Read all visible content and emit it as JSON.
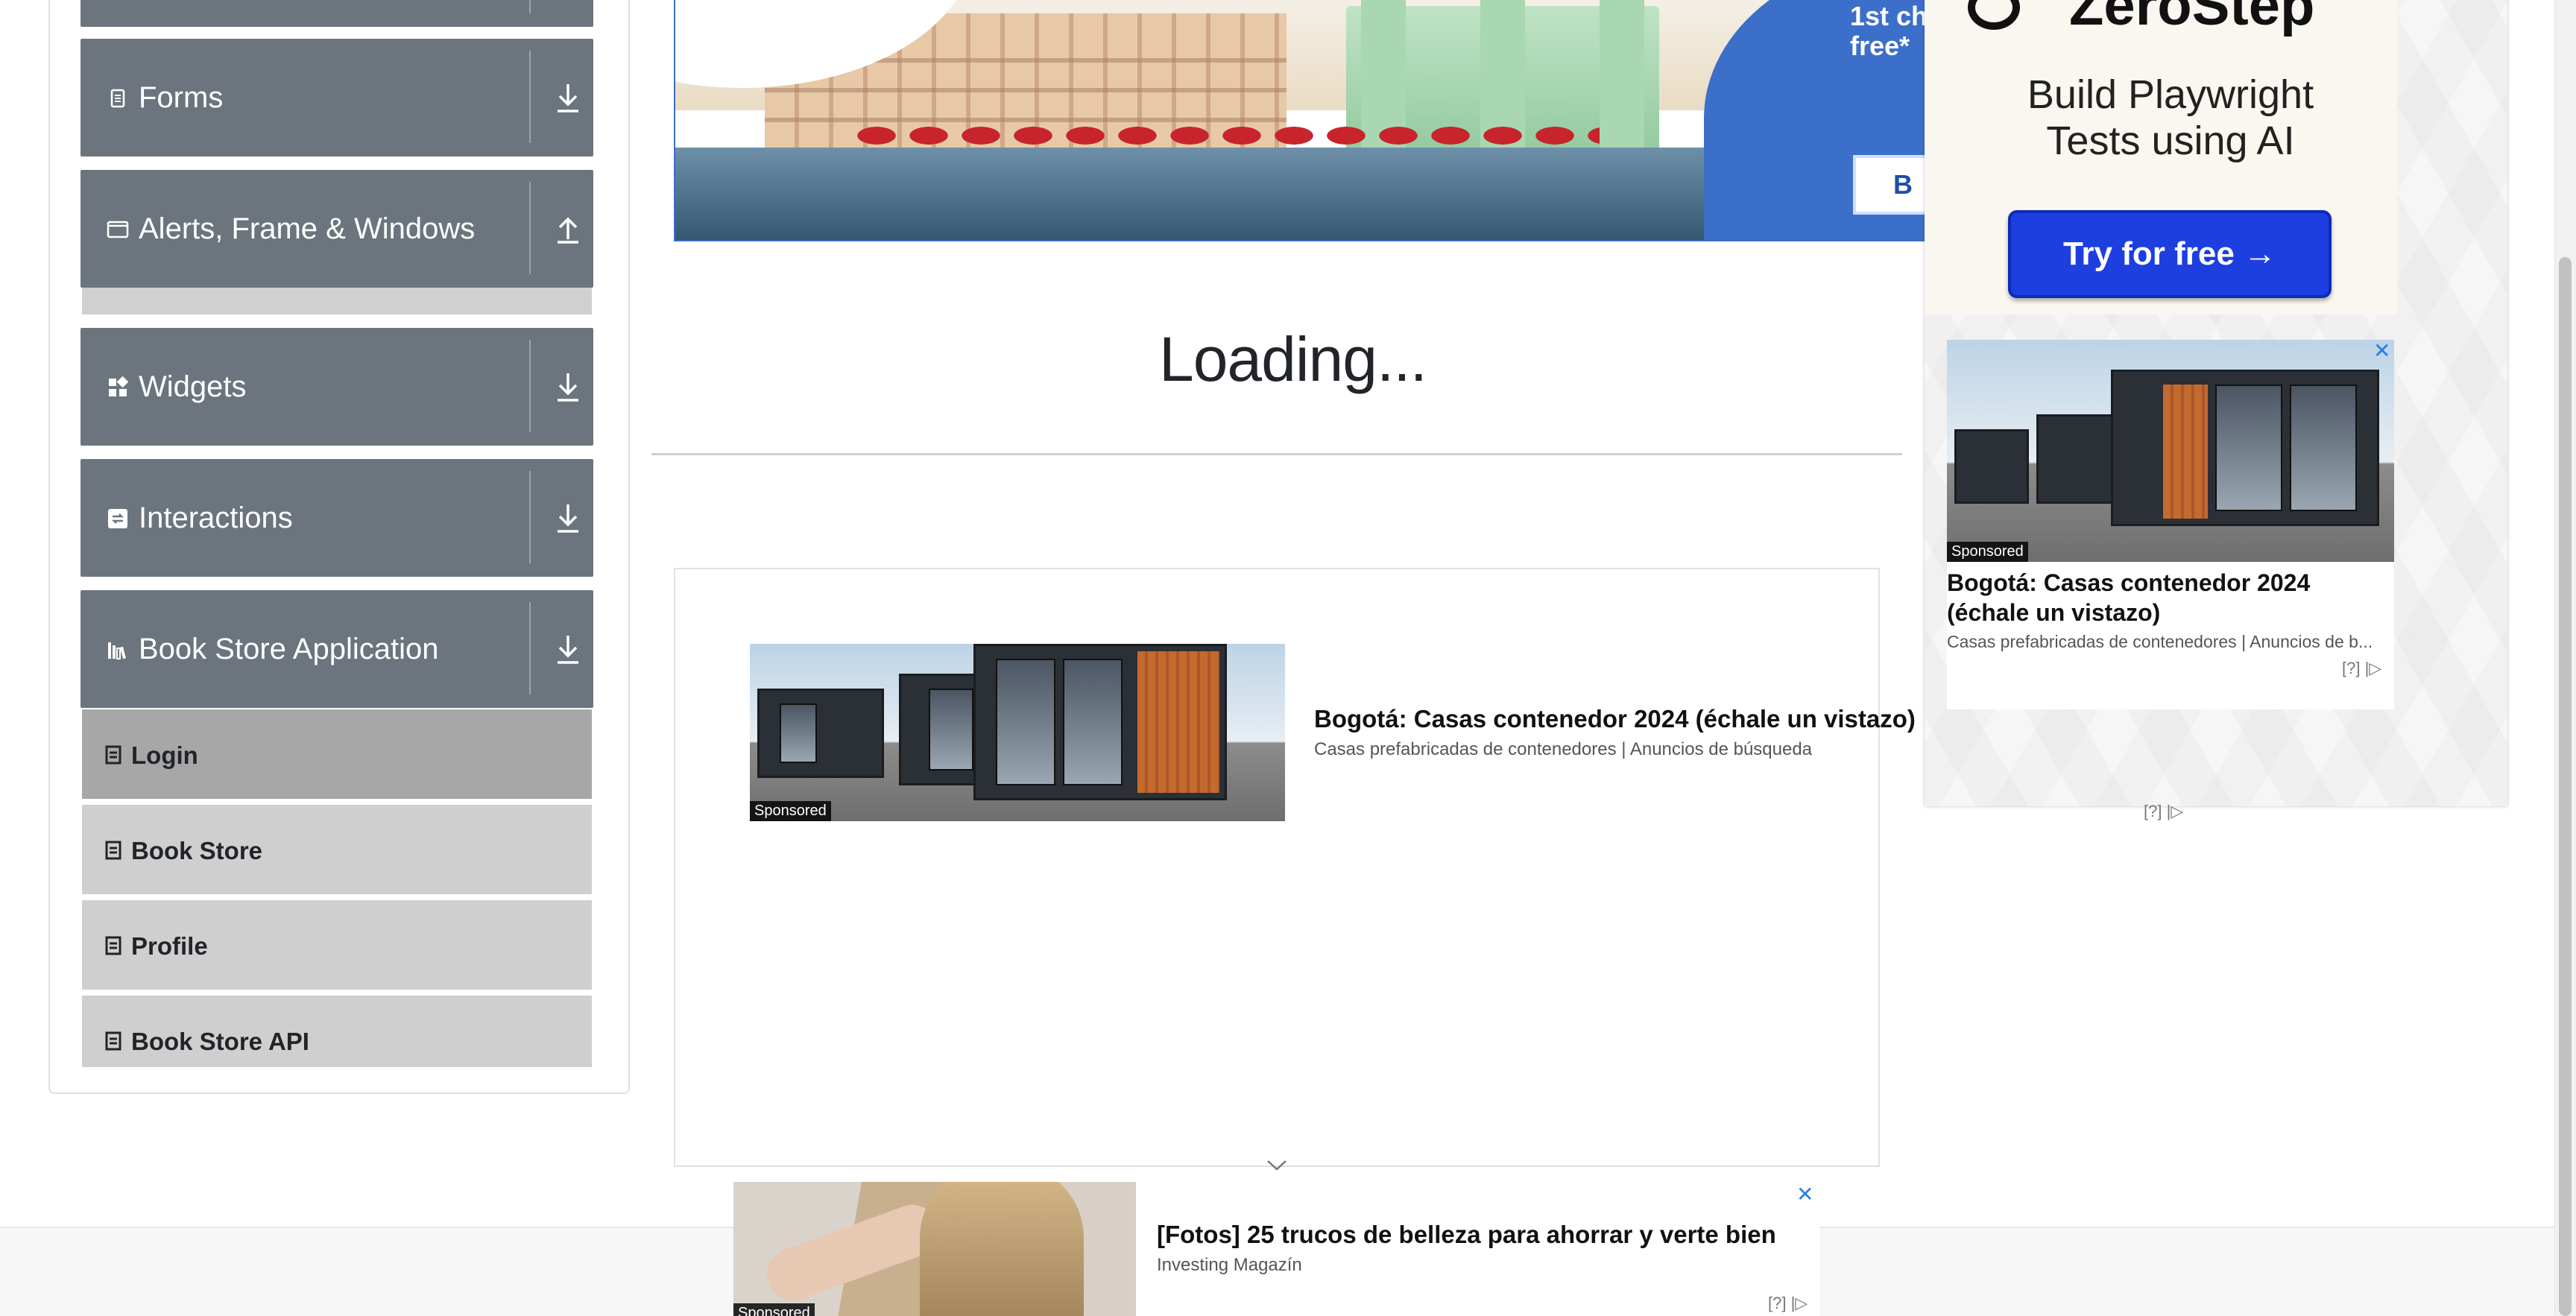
{
  "sidebar": {
    "groups": [
      {
        "label": "Forms",
        "icon": "document-icon",
        "arrow": "download-arrow-icon"
      },
      {
        "label": "Alerts, Frame & Windows",
        "icon": "window-icon",
        "arrow": "upload-arrow-icon"
      },
      {
        "label": "Widgets",
        "icon": "widgets-icon",
        "arrow": "download-arrow-icon"
      },
      {
        "label": "Interactions",
        "icon": "interactions-icon",
        "arrow": "download-arrow-icon"
      },
      {
        "label": "Book Store Application",
        "icon": "books-icon",
        "arrow": "download-arrow-icon"
      }
    ],
    "book_store_items": [
      {
        "label": "Login",
        "active": true
      },
      {
        "label": "Book Store",
        "active": false
      },
      {
        "label": "Profile",
        "active": false
      },
      {
        "label": "Book Store API",
        "active": false
      }
    ]
  },
  "main": {
    "loading_text": "Loading..."
  },
  "ads": {
    "banner": {
      "promo_text_line1": "1st ch",
      "promo_text_line2": "free*",
      "button_label": "B"
    },
    "zerostep": {
      "brand": "ZeroStep",
      "headline": "Build Playwright Tests using AI",
      "cta": "Try for free →"
    },
    "right_sponsored": {
      "tag": "Sponsored",
      "title": "Bogotá: Casas contenedor 2024 (échale un vistazo)",
      "subtitle": "Casas prefabricadas de contenedores | Anuncios de b...",
      "choices": "[?] |▷",
      "close": "✕"
    },
    "middle_sponsored": {
      "tag": "Sponsored",
      "title": "Bogotá: Casas contenedor 2024 (échale un vistazo)",
      "subtitle": "Casas prefabricadas de contenedores | Anuncios de búsqueda",
      "choices": "[?] |▷"
    },
    "bottom_sponsored": {
      "tag": "Sponsored",
      "title": "[Fotos] 25 trucos de belleza para ahorrar y verte bien",
      "subtitle": "Investing Magazín",
      "choices": "[?] |▷",
      "close": "✕"
    }
  },
  "colors": {
    "sidebar_group_bg": "#6c757d",
    "sidebar_item_bg": "#cfcfcf",
    "sidebar_item_active_bg": "#a7a7a7",
    "zerostep_cta": "#1d3fe0",
    "ad_choice_blue": "#2a7de1"
  }
}
